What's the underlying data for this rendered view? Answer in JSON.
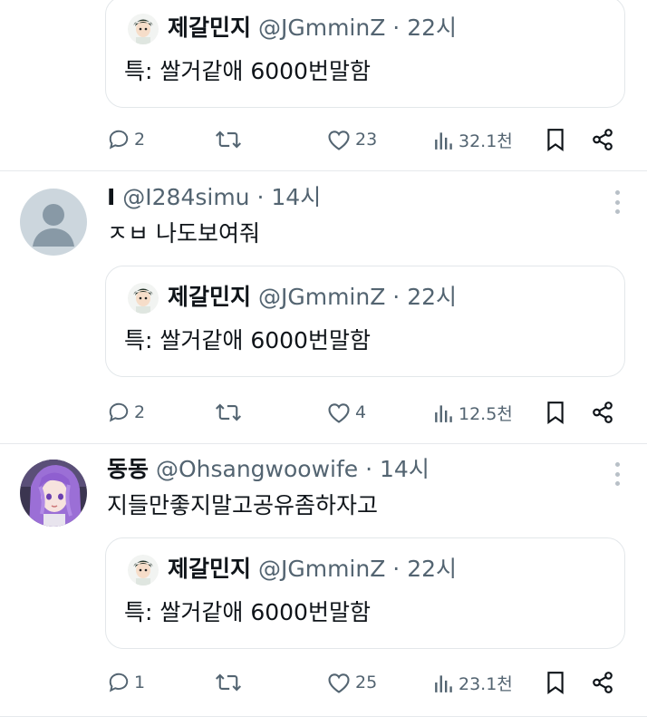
{
  "quoted": {
    "name": "제갈민지",
    "handle": "@JGmminZ",
    "separator": "·",
    "time": "22시",
    "text": "특: 쌀거같애 6000번말함"
  },
  "tweets": [
    {
      "actions": {
        "reply": "2",
        "retweet": "",
        "like": "23",
        "views": "32.1천"
      }
    },
    {
      "name": "I",
      "handle": "@I284simu",
      "separator": "·",
      "time": "14시",
      "text": "ㅈㅂ 나도보여줘",
      "actions": {
        "reply": "2",
        "retweet": "",
        "like": "4",
        "views": "12.5천"
      }
    },
    {
      "name": "동동",
      "handle": "@Ohsangwoowife",
      "separator": "·",
      "time": "14시",
      "text": "지들만좋지말고공유좀하자고",
      "actions": {
        "reply": "1",
        "retweet": "",
        "like": "25",
        "views": "23.1천"
      }
    }
  ],
  "colors": {
    "text": "#0f1419",
    "muted": "#536471",
    "border": "#e3e7ea",
    "divider": "#e6e9ec"
  },
  "icons": [
    "reply-icon",
    "retweet-icon",
    "like-icon",
    "views-icon",
    "bookmark-icon",
    "share-icon",
    "more-icon"
  ]
}
